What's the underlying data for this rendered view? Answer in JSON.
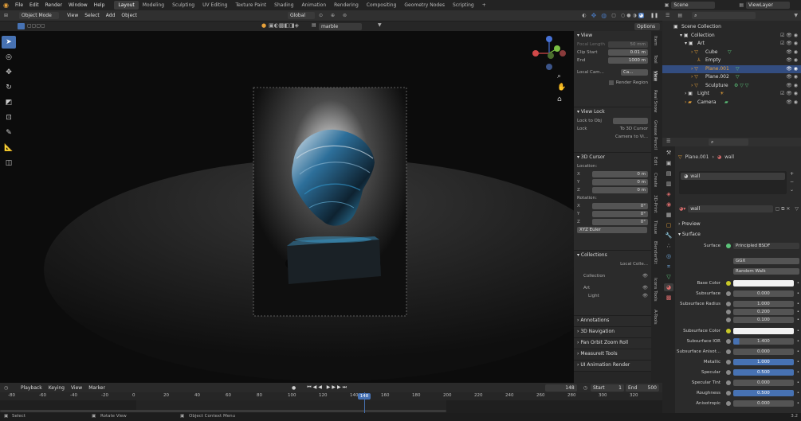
{
  "menu": [
    "File",
    "Edit",
    "Render",
    "Window",
    "Help"
  ],
  "workspaces": [
    "Layout",
    "Modeling",
    "Sculpting",
    "UV Editing",
    "Texture Paint",
    "Shading",
    "Animation",
    "Rendering",
    "Compositing",
    "Geometry Nodes",
    "Scripting"
  ],
  "active_workspace": "Layout",
  "scene": "Scene",
  "view_layer": "ViewLayer",
  "viewport_header": {
    "mode": "Object Mode",
    "menus": [
      "View",
      "Select",
      "Add",
      "Object"
    ],
    "transform": "Global",
    "options": "Options",
    "material": "marble"
  },
  "npanel": {
    "view": {
      "title": "View",
      "focal_label": "Focal Length",
      "focal_value": "50 mm",
      "clip_start_label": "Clip Start",
      "clip_start": "0.01 m",
      "end_label": "End",
      "end": "1000 m",
      "local_camera": "Local Cam...",
      "local_cam_value": "Ca...",
      "render_region": "Render Region"
    },
    "view_lock": {
      "title": "View Lock",
      "lock_to_obj": "Lock to Obj",
      "lock": "Lock",
      "to_3d_cursor": "To 3D Cursor",
      "camera_to_view": "Camera to Vi..."
    },
    "cursor": {
      "title": "3D Cursor",
      "location": "Location:",
      "x": "X",
      "y": "Y",
      "z": "Z",
      "loc_vals": [
        "0 m",
        "0 m",
        "0 m"
      ],
      "rotation": "Rotation:",
      "rot_vals": [
        "0°",
        "0°",
        "0°"
      ],
      "euler": "XYZ Euler"
    },
    "collections": {
      "title": "Collections",
      "local": "Local Colle...",
      "items": [
        "Collection",
        "Art",
        "Light"
      ]
    },
    "extra": [
      "Annotations",
      "3D Navigation",
      "Pan Orbit Zoom Roll",
      "MeasureIt Tools",
      "UI Animation Render"
    ]
  },
  "side_tabs": [
    "Item",
    "Tool",
    "View",
    "Real Snow",
    "Grease Pencil",
    "Edit",
    "Create",
    "3D-Print",
    "Tissue",
    "BlenderKit",
    "Icons Tools",
    "A-Tools"
  ],
  "outliner": {
    "rows": [
      {
        "label": "Scene Collection",
        "indent": 0
      },
      {
        "label": "Collection",
        "indent": 1
      },
      {
        "label": "Art",
        "indent": 2
      },
      {
        "label": "Cube",
        "indent": 3
      },
      {
        "label": "Empty",
        "indent": 3
      },
      {
        "label": "Plane.001",
        "indent": 3,
        "selected": true
      },
      {
        "label": "Plane.002",
        "indent": 3
      },
      {
        "label": "Sculpture",
        "indent": 3
      },
      {
        "label": "Light",
        "indent": 2
      },
      {
        "label": "Camera",
        "indent": 2
      }
    ]
  },
  "properties": {
    "object": "Plane.001",
    "material_slot": "wall",
    "material": "wall",
    "preview": "Preview",
    "surface_header": "Surface",
    "surface_label": "Surface",
    "surface_value": "Principled BSDF",
    "distribution": "GGX",
    "subsurface_method": "Random Walk",
    "rows": [
      {
        "label": "Base Color",
        "value": "",
        "type": "color"
      },
      {
        "label": "Subsurface",
        "value": "0.000"
      },
      {
        "label": "Subsurface Radius",
        "value": "1.000"
      },
      {
        "label": "",
        "value": "0.200"
      },
      {
        "label": "",
        "value": "0.100"
      },
      {
        "label": "Subsurface Color",
        "value": "",
        "type": "color"
      },
      {
        "label": "Subsurface IOR",
        "value": "1.400"
      },
      {
        "label": "Subsurface Anisot...",
        "value": "0.000"
      },
      {
        "label": "Metallic",
        "value": "1.000",
        "type": "blue"
      },
      {
        "label": "Specular",
        "value": "0.500",
        "type": "blue"
      },
      {
        "label": "Specular Tint",
        "value": "0.000"
      },
      {
        "label": "Roughness",
        "value": "0.500",
        "type": "blue"
      },
      {
        "label": "Anisotropic",
        "value": "0.000"
      }
    ]
  },
  "timeline": {
    "menus": [
      "Playback",
      "Keying",
      "View",
      "Marker"
    ],
    "current": "148",
    "start_label": "Start",
    "start": "1",
    "end_label": "End",
    "end": "500",
    "ticks": [
      "-80",
      "-60",
      "-40",
      "-20",
      "0",
      "20",
      "40",
      "60",
      "80",
      "100",
      "120",
      "140",
      "160",
      "180",
      "200",
      "220",
      "240",
      "260",
      "280",
      "300",
      "320"
    ]
  },
  "status": {
    "select": "Select",
    "rotate": "Rotate View",
    "context": "Object Context Menu",
    "version": "3.2"
  },
  "colors": {
    "accent": "#4772b3",
    "orange": "#e8a23a"
  }
}
